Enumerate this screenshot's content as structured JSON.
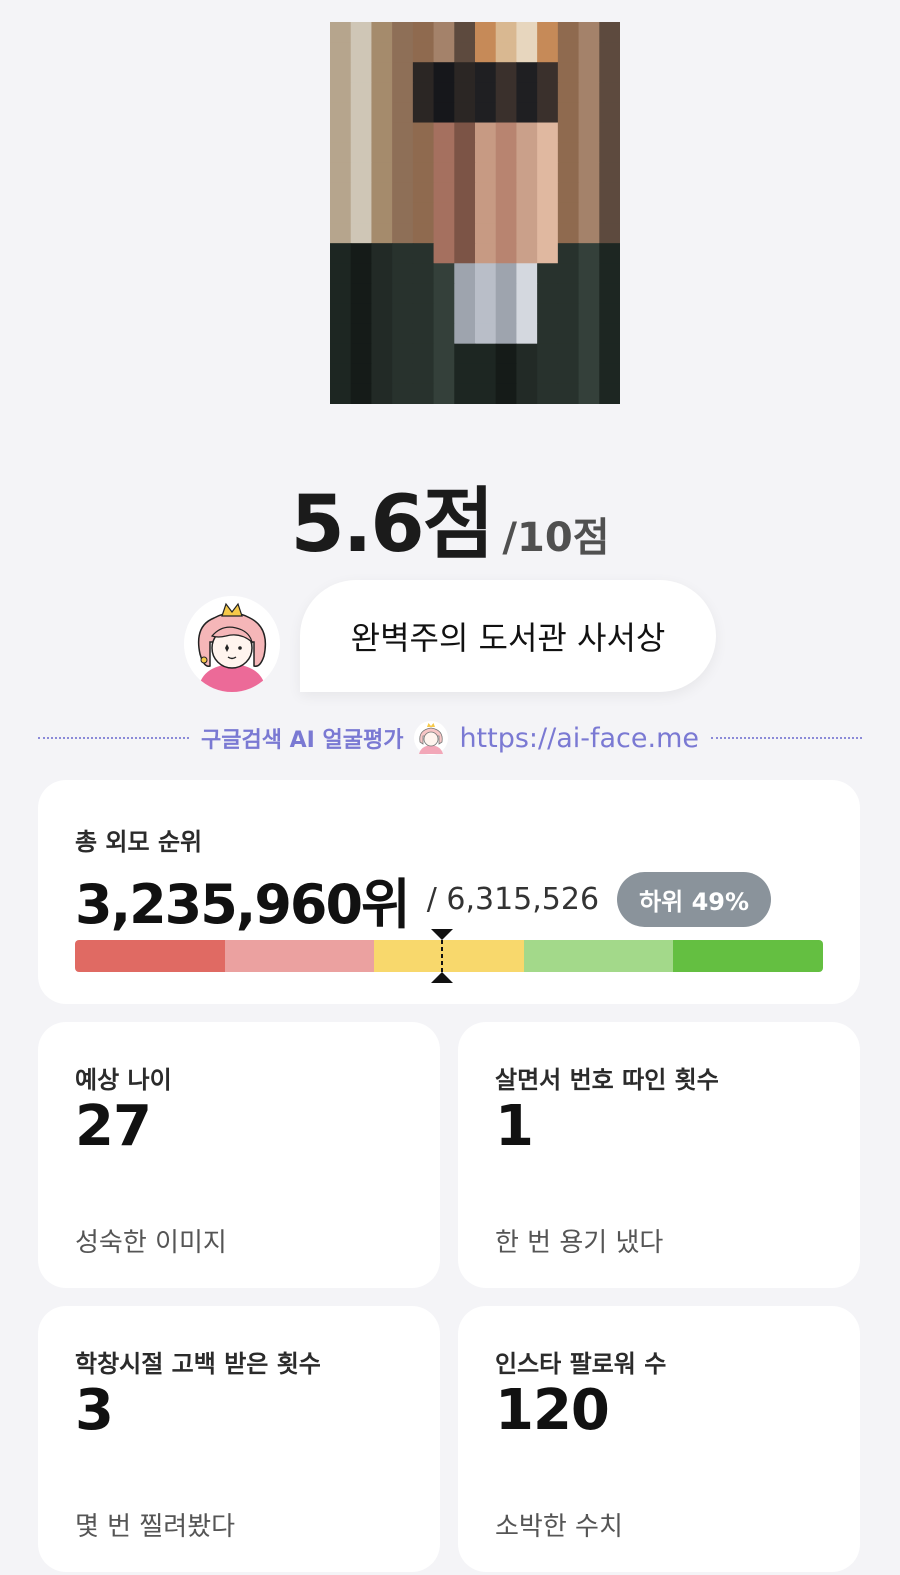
{
  "header": {
    "back_icon": "chevron-left-icon"
  },
  "result": {
    "score": "5.6점",
    "score_max": "/10점",
    "type_title": "완벽주의 도서관 사서상",
    "avatar_icon": "princess-avatar-icon"
  },
  "brand": {
    "label": "구글검색 AI 얼굴평가",
    "icon": "princess-avatar-icon",
    "url": "https://ai-face.me"
  },
  "rank": {
    "label": "총 외모 순위",
    "value": "3,235,960위",
    "total": "/ 6,315,526",
    "badge": "하위 49%",
    "position_fraction": 0.49,
    "bar_colors": [
      "#e06a63",
      "#eba1a0",
      "#f8d86c",
      "#a3d98a",
      "#64bf41"
    ]
  },
  "stats": [
    {
      "label": "예상 나이",
      "value": "27",
      "desc": "성숙한 이미지"
    },
    {
      "label": "살면서 번호 따인 횟수",
      "value": "1",
      "desc": "한 번 용기 냈다"
    },
    {
      "label": "학창시절 고백 받은 횟수",
      "value": "3",
      "desc": "몇 번 찔려봤다"
    },
    {
      "label": "인스타 팔로워 수",
      "value": "120",
      "desc": "소박한 수치"
    }
  ]
}
